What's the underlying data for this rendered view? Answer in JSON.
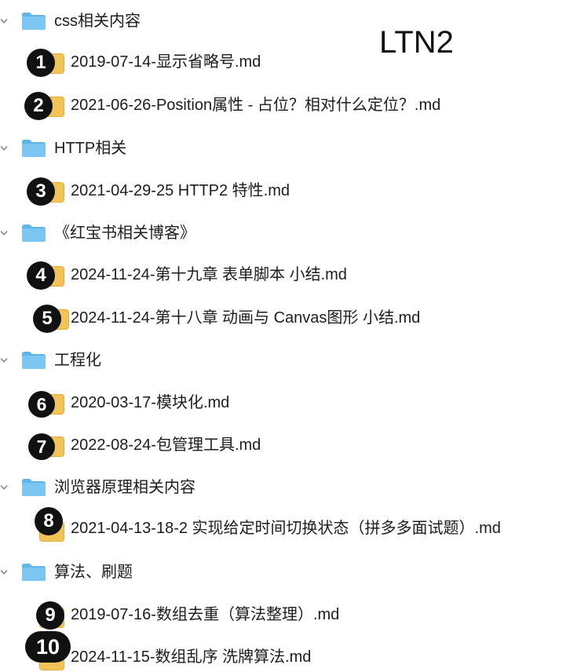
{
  "watermark": "LTN2",
  "folders": [
    {
      "name": "css相关内容",
      "files": [
        {
          "badge": "1",
          "name": "2019-07-14-显示省略号.md"
        },
        {
          "badge": "2",
          "name": "2021-06-26-Position属性 - 占位？相对什么定位？.md"
        }
      ]
    },
    {
      "name": "HTTP相关",
      "files": [
        {
          "badge": "3",
          "name": "2021-04-29-25 HTTP2 特性.md"
        }
      ]
    },
    {
      "name": "《红宝书相关博客》",
      "files": [
        {
          "badge": "4",
          "name": "2024-11-24-第十九章 表单脚本 小结.md"
        },
        {
          "badge": "5",
          "name": "2024-11-24-第十八章 动画与 Canvas图形 小结.md"
        }
      ]
    },
    {
      "name": "工程化",
      "files": [
        {
          "badge": "6",
          "name": "2020-03-17-模块化.md"
        },
        {
          "badge": "7",
          "name": "2022-08-24-包管理工具.md"
        }
      ]
    },
    {
      "name": "浏览器原理相关内容",
      "files": [
        {
          "badge": "8",
          "name": "2021-04-13-18-2 实现给定时间切换状态（拼多多面试题）.md"
        }
      ]
    },
    {
      "name": "算法、刷题",
      "files": [
        {
          "badge": "9",
          "name": "2019-07-16-数组去重（算法整理）.md"
        },
        {
          "badge": "10",
          "name": "2024-11-15-数组乱序 洗牌算法.md"
        }
      ]
    }
  ],
  "colors": {
    "folder": "#7cc7f1",
    "folder_tab": "#5fb4e8",
    "badge": "#111111",
    "file_tab": "#f2c357"
  }
}
